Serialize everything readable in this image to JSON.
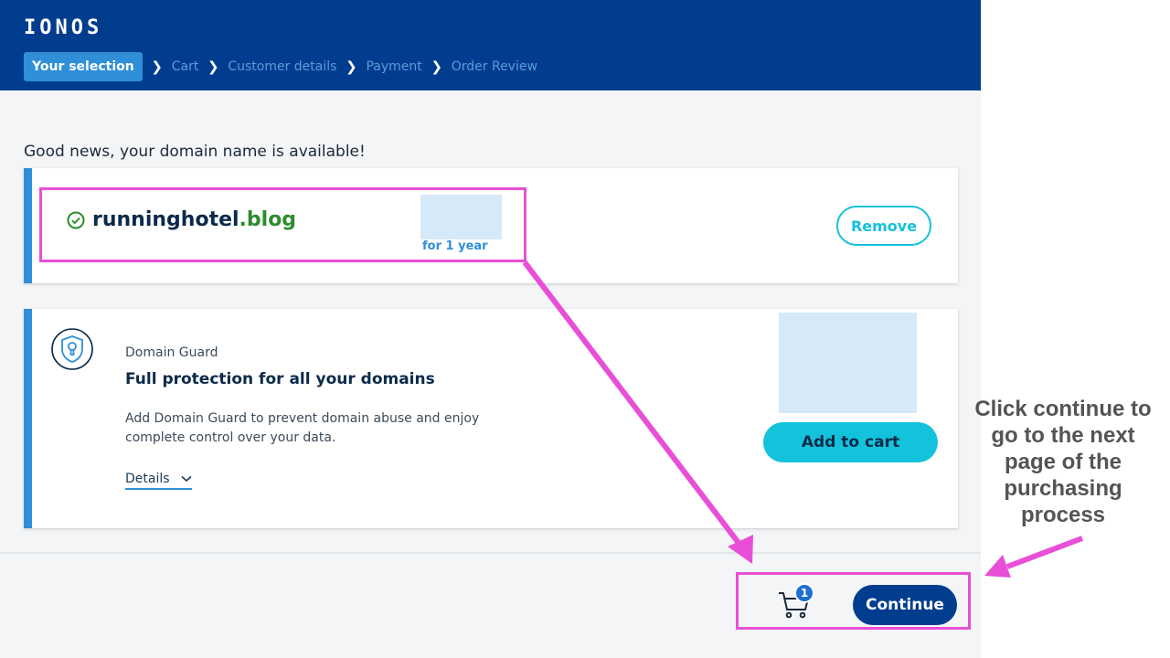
{
  "header": {
    "logo": "IONOS",
    "breadcrumb": [
      "Your selection",
      "Cart",
      "Customer details",
      "Payment",
      "Order Review"
    ],
    "separator": "❯"
  },
  "intro_text": "Good news, your domain name is available!",
  "domain": {
    "name": "runninghotel",
    "tld": ".blog",
    "period": "for 1 year",
    "remove_label": "Remove"
  },
  "guard": {
    "label": "Domain Guard",
    "title": "Full protection for all your domains",
    "description": "Add Domain Guard to prevent domain abuse and enjoy complete control over your data.",
    "details_label": "Details",
    "add_label": "Add to cart"
  },
  "footer": {
    "cart_count": "1",
    "continue_label": "Continue"
  },
  "annotation": {
    "callout": "Click continue to go to the next page of the purchasing process",
    "color": "#e94fd6"
  },
  "colors": {
    "header_bg": "#003d8f",
    "accent_blue": "#2f8fd9",
    "cta_cyan": "#13c2db",
    "tld_green": "#2c8c2c"
  }
}
